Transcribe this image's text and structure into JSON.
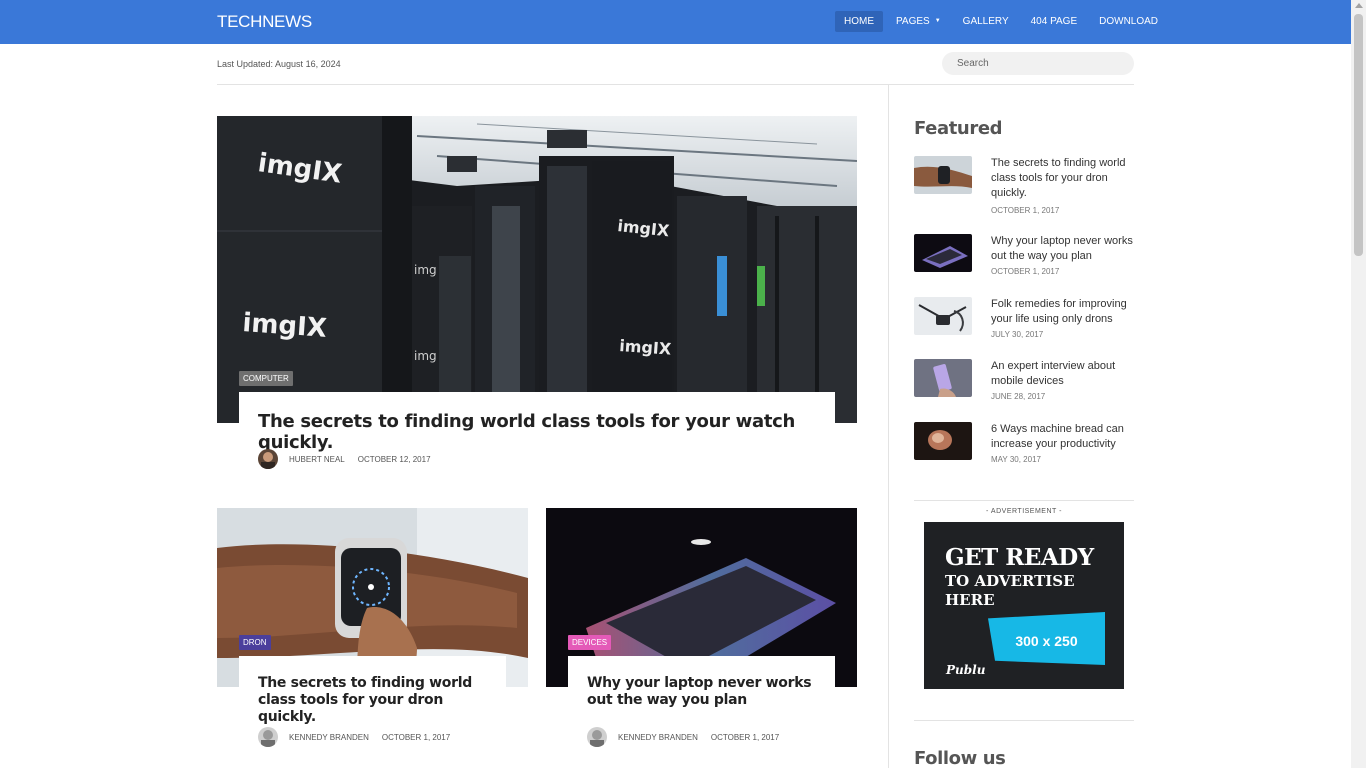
{
  "site": {
    "brand": "TECHNEWS"
  },
  "nav": {
    "items": [
      {
        "label": "HOME",
        "active": true
      },
      {
        "label": "PAGES",
        "dropdown": true
      },
      {
        "label": "GALLERY"
      },
      {
        "label": "404 PAGE"
      },
      {
        "label": "DOWNLOAD"
      }
    ]
  },
  "subbar": {
    "updated": "Last Updated: August 16, 2024",
    "search_placeholder": "Search"
  },
  "hero": {
    "tag": "COMPUTER",
    "tag_color": "#6f6f6f",
    "title": "The secrets to finding world class tools for your watch quickly.",
    "author": "HUBERT NEAL",
    "date": "OCTOBER 12, 2017",
    "image_text": [
      "imgIX",
      "imgIX",
      "imgIX",
      "imgIX",
      "img",
      "img"
    ]
  },
  "cards": [
    {
      "tag": "DRON",
      "tag_color": "#4b3f9c",
      "title": "The secrets to finding world class tools for your dron quickly.",
      "author": "KENNEDY BRANDEN",
      "date": "OCTOBER 1, 2017"
    },
    {
      "tag": "DEVICES",
      "tag_color": "#e45ab8",
      "title": "Why your laptop never works out the way you plan",
      "author": "KENNEDY BRANDEN",
      "date": "OCTOBER 1, 2017"
    }
  ],
  "sidebar": {
    "featured_heading": "Featured",
    "featured": [
      {
        "title": "The secrets to finding world class tools for your dron quickly.",
        "date": "OCTOBER 1, 2017"
      },
      {
        "title": "Why your laptop never works out the way you plan",
        "date": "OCTOBER 1, 2017"
      },
      {
        "title": "Folk remedies for improving your life using only drons",
        "date": "JULY 30, 2017"
      },
      {
        "title": "An expert interview about mobile devices",
        "date": "JUNE 28, 2017"
      },
      {
        "title": "6 Ways machine bread can increase your productivity",
        "date": "MAY 30, 2017"
      }
    ],
    "ad_label": "- ADVERTISEMENT -",
    "ad": {
      "line1": "GET READY",
      "line2": "TO ADVERTISE",
      "line3": "HERE",
      "size": "300 x 250",
      "logo": "Publu"
    },
    "follow_heading": "Follow us"
  }
}
